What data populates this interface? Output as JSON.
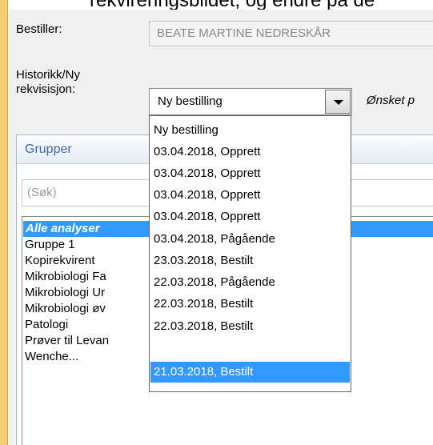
{
  "page": {
    "top_partial_text": "rekvireringsbildet, og endre på de"
  },
  "form": {
    "bestiller_label": "Bestiller:",
    "bestiller_value": "BEATE MARTINE NEDRESKÅR",
    "historikk_label_line1": "Historikk/Ny",
    "historikk_label_line2": "rekvisisjon:",
    "historikk_selected": "Ny bestilling",
    "onsket_label_partial": "Ønsket p"
  },
  "dropdown": {
    "selected_index": 11,
    "items": [
      "Ny bestilling",
      "03.04.2018, Opprett",
      "03.04.2018, Opprett",
      "03.04.2018, Opprett",
      "03.04.2018, Opprett",
      "03.04.2018, Pågående",
      "23.03.2018, Bestilt",
      "22.03.2018, Pågående",
      "22.03.2018, Bestilt",
      "22.03.2018, Bestilt",
      "21.03.2018, Bestilt"
    ]
  },
  "grupper": {
    "title": "Grupper",
    "search_placeholder": "(Søk)",
    "items": [
      "Alle analyser",
      "Gruppe 1",
      "Kopirekvirent",
      "Mikrobiologi Fa",
      "Mikrobiologi Ur",
      "Mikrobiologi øv",
      "Patologi",
      "Prøver til Levan",
      "Wenche..."
    ]
  },
  "colors": {
    "highlight": "#3399ff",
    "header_text": "#3d67a8",
    "left_accent": "#f2cf73"
  }
}
